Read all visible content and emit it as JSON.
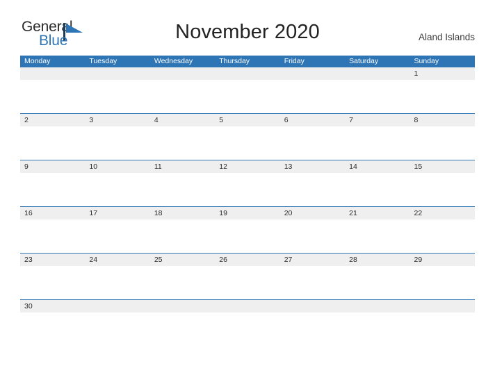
{
  "brand": {
    "name_part1": "General",
    "name_part2": "Blue",
    "flag_icon": "blue-flag-triangle",
    "color_dark": "#2b2b2b",
    "color_blue": "#2e75b6"
  },
  "header": {
    "title": "November 2020",
    "region": "Aland Islands"
  },
  "theme": {
    "accent": "#2e75b6",
    "row_strip": "#efefef",
    "text": "#2b2b2b",
    "background": "#ffffff"
  },
  "calendar": {
    "month": "November",
    "year": "2020",
    "weekday_headers": [
      "Monday",
      "Tuesday",
      "Wednesday",
      "Thursday",
      "Friday",
      "Saturday",
      "Sunday"
    ],
    "weeks": [
      [
        "",
        "",
        "",
        "",
        "",
        "",
        "1"
      ],
      [
        "2",
        "3",
        "4",
        "5",
        "6",
        "7",
        "8"
      ],
      [
        "9",
        "10",
        "11",
        "12",
        "13",
        "14",
        "15"
      ],
      [
        "16",
        "17",
        "18",
        "19",
        "20",
        "21",
        "22"
      ],
      [
        "23",
        "24",
        "25",
        "26",
        "27",
        "28",
        "29"
      ],
      [
        "30",
        "",
        "",
        "",
        "",
        "",
        ""
      ]
    ]
  }
}
